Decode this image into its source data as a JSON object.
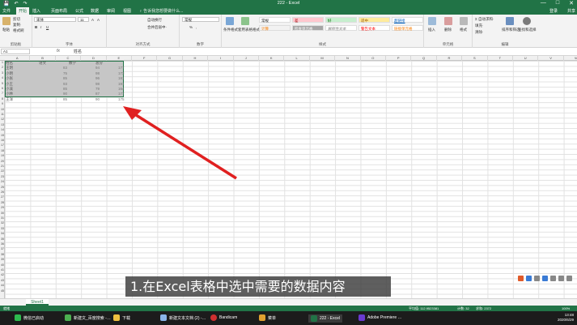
{
  "titlebar": {
    "title": "222 - Excel",
    "login": "登录",
    "qat_save": "💾",
    "qat_undo": "↶",
    "qat_redo": "↷",
    "win_min": "—",
    "win_max": "□",
    "win_close": "✕"
  },
  "tabs": [
    "文件",
    "开始",
    "插入",
    "页面布局",
    "公式",
    "数据",
    "审阅",
    "视图"
  ],
  "tellme": "♀ 告诉我您想要做什么...",
  "account": "登录",
  "share": "共享",
  "ribbon": {
    "clipboard": {
      "paste": "粘贴",
      "cut": "剪切",
      "copy": "复制·",
      "painter": "格式刷",
      "label": "剪贴板"
    },
    "font": {
      "family": "宋体",
      "size": "11",
      "bold": "B",
      "italic": "I",
      "underline": "U",
      "grow": "A",
      "shrink": "A",
      "label": "字体"
    },
    "align": {
      "wrap": "自动换行",
      "merge": "合并后居中·",
      "label": "对齐方式"
    },
    "number": {
      "format": "常规",
      "percent": "%",
      "comma": ",",
      "label": "数字"
    },
    "cond": "条件格式",
    "table": "套用表格格式",
    "styles": {
      "normal": "常规",
      "bad": "差",
      "good": "好",
      "neutral": "适中",
      "calc": "计算",
      "check": "检查单元格",
      "explain": "解释性文本",
      "warn": "警告文本",
      "link": "超链接",
      "linked": "链接单元格",
      "label": "样式"
    },
    "cells": {
      "insert": "插入",
      "delete": "删除",
      "format": "格式",
      "label": "单元格"
    },
    "editing": {
      "autosum": "Σ 自动求和·",
      "fill": "填充·",
      "clear": "清除·",
      "sort": "排序和筛选",
      "find": "查找和选择",
      "label": "编辑"
    }
  },
  "formula_bar": {
    "name_box": "A1",
    "fx": "fx",
    "content": "姓名"
  },
  "columns": [
    "A",
    "B",
    "C",
    "D",
    "E",
    "F",
    "G",
    "H",
    "I",
    "J",
    "K",
    "L",
    "M",
    "N",
    "O",
    "P",
    "Q",
    "R",
    "S",
    "T",
    "U",
    "V",
    "W"
  ],
  "rows": [
    "1",
    "2",
    "3",
    "4",
    "5",
    "6",
    "7",
    "8",
    "9",
    "10",
    "11",
    "12",
    "13",
    "14",
    "15",
    "16",
    "17",
    "18",
    "19",
    "20",
    "21",
    "22",
    "23",
    "24",
    "25",
    "26",
    "27",
    "28",
    "29",
    "30",
    "31",
    "32",
    "33",
    "34",
    "35",
    "36",
    "37",
    "38",
    "39",
    "40",
    "41",
    "42",
    "43",
    "44",
    "45"
  ],
  "table": {
    "headers": [
      "姓名",
      "语文",
      "数学",
      "总分"
    ],
    "rows": [
      [
        "王明",
        "83",
        "94",
        "177"
      ],
      [
        "小明",
        "75",
        "98",
        "173"
      ],
      [
        "小张",
        "85",
        "96",
        "181"
      ],
      [
        "小王",
        "93",
        "98",
        "191"
      ],
      [
        "小溪",
        "85",
        "79",
        "164"
      ],
      [
        "小林",
        "90",
        "87",
        "177"
      ],
      [
        "王洋",
        "85",
        "90",
        "175"
      ]
    ]
  },
  "sheet_tab": "Sheet1",
  "status": {
    "ready": "就绪",
    "average": "平均值: 112.9523381",
    "count": "计数: 32",
    "sum": "求和: 2372",
    "zoom": "100%"
  },
  "caption": "1.在Excel表格中选中需要的数据内容",
  "taskbar": {
    "items": [
      "微信已启动",
      "新建文_百度搜索 -…",
      "下载",
      "新建文本文档 (2) -…",
      "Bandicam",
      "菜单",
      "222 - Excel",
      "Adobe Premiere …"
    ],
    "time": "13:48",
    "date": "2020/6/29"
  },
  "colors": {
    "excel_green": "#217346",
    "arrow_red": "#e02020",
    "selection_gray": "#c6c6c6"
  }
}
